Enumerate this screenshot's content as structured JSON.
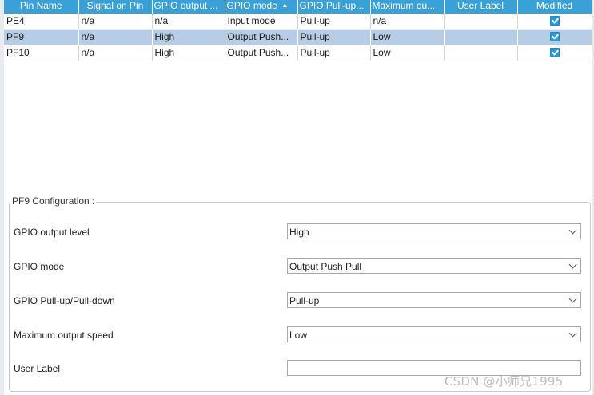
{
  "table": {
    "headers": [
      "Pin Name",
      "Signal on Pin",
      "GPIO output ...",
      "GPIO mode",
      "GPIO Pull-up...",
      "Maximum ou...",
      "User Label",
      "Modified"
    ],
    "rows": [
      {
        "pin": "PE4",
        "signal": "n/a",
        "output": "n/a",
        "mode": "Input mode",
        "pull": "Pull-up",
        "speed": "n/a",
        "label": "",
        "modified": true
      },
      {
        "pin": "PF9",
        "signal": "n/a",
        "output": "High",
        "mode": "Output Push...",
        "pull": "Pull-up",
        "speed": "Low",
        "label": "",
        "modified": true,
        "selected": true
      },
      {
        "pin": "PF10",
        "signal": "n/a",
        "output": "High",
        "mode": "Output Push...",
        "pull": "Pull-up",
        "speed": "Low",
        "label": "",
        "modified": true
      }
    ]
  },
  "config": {
    "title": "PF9 Configuration :",
    "fields": [
      {
        "label": "GPIO output level",
        "value": "High"
      },
      {
        "label": "GPIO mode",
        "value": "Output Push Pull"
      },
      {
        "label": "GPIO Pull-up/Pull-down",
        "value": "Pull-up"
      },
      {
        "label": "Maximum output speed",
        "value": "Low"
      },
      {
        "label": "User Label",
        "value": ""
      }
    ]
  },
  "watermark": "CSDN @小师兄1995",
  "colors": {
    "header": "#3aa0d8",
    "selected_row": "#b6cde5",
    "checkbox": "#2a9bd7"
  }
}
